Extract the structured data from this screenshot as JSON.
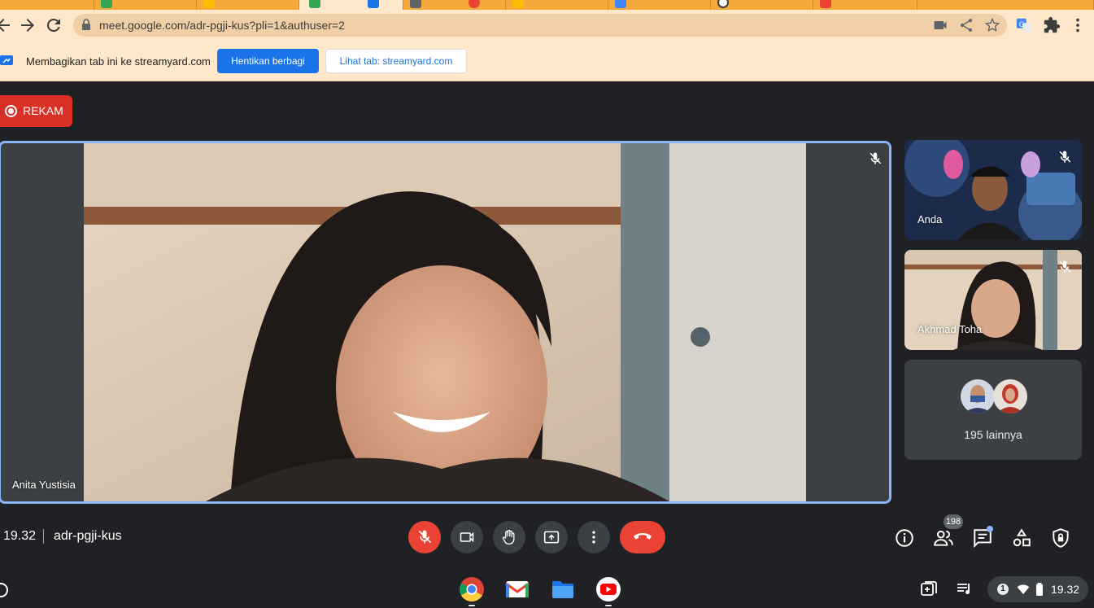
{
  "browser": {
    "url": "meet.google.com/adr-pgji-kus?pli=1&authuser=2",
    "tab_colors": [
      "#34a853",
      "#fbbc04",
      "#1a73e8",
      "#ea4335"
    ]
  },
  "sharing_bar": {
    "message": "Membagikan tab ini ke streamyard.com",
    "stop_label": "Hentikan berbagi",
    "view_label": "Lihat tab: streamyard.com"
  },
  "recording": {
    "label": "REKAM"
  },
  "main_tile": {
    "name": "Anita Yustisia",
    "muted": true
  },
  "thumbnails": [
    {
      "name": "Anda",
      "muted": true
    },
    {
      "name": "Akhmad Toha",
      "muted": true
    }
  ],
  "others_tile": {
    "label": "195 lainnya"
  },
  "bottom_bar": {
    "time": "19.32",
    "meeting_code": "adr-pgji-kus",
    "participant_count": "198"
  },
  "shelf": {
    "tray_notification_count": "1",
    "tray_time": "19.32"
  },
  "colors": {
    "accent_blue": "#1a73e8",
    "meet_red": "#ea4335",
    "active_border": "#8ab4f8",
    "browser_theme": "#f6a93b"
  }
}
